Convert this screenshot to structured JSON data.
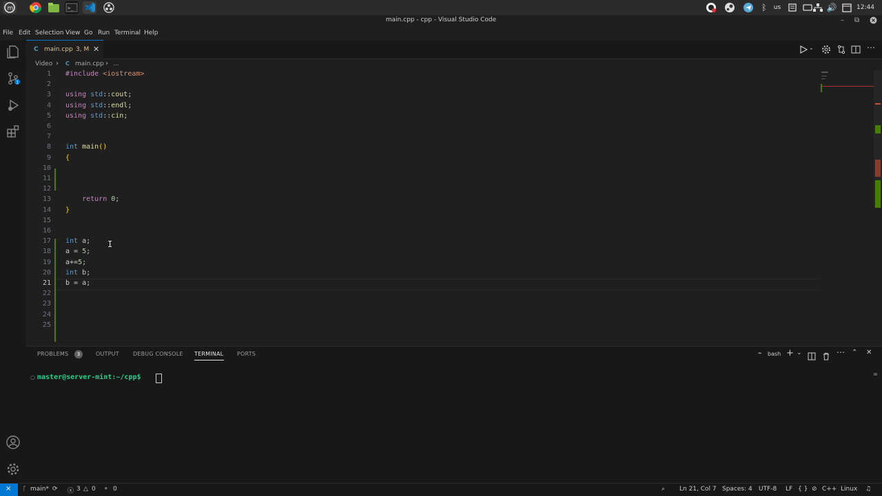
{
  "window": {
    "title": "main.cpp - cpp - Visual Studio Code"
  },
  "os_bar": {
    "clock": "12:44",
    "keyboard_layout": "us",
    "taskbar_icons": [
      "mint-menu-icon",
      "chrome-icon",
      "files-icon",
      "terminal-icon",
      "vscode-icon",
      "obs-icon"
    ]
  },
  "menu": [
    "File",
    "Edit",
    "Selection",
    "View",
    "Go",
    "Run",
    "Terminal",
    "Help"
  ],
  "tab": {
    "label": "main.cpp",
    "status": "3, M"
  },
  "breadcrumb": {
    "folder": "Video",
    "file": "main.cpp",
    "more": "..."
  },
  "editor": {
    "lines": [
      {
        "n": "1",
        "html": "<span class=\"pp\">#include</span> <span class=\"str\">&lt;iostream&gt;</span>"
      },
      {
        "n": "2",
        "html": ""
      },
      {
        "n": "3",
        "html": "<span class=\"pp\">using</span> <span class=\"kw\">std</span>::<span class=\"fn\">cout</span>;"
      },
      {
        "n": "4",
        "html": "<span class=\"pp\">using</span> <span class=\"kw\">std</span>::<span class=\"fn\">endl</span>;"
      },
      {
        "n": "5",
        "html": "<span class=\"pp\">using</span> <span class=\"kw\">std</span>::<span class=\"fn\">cin</span>;"
      },
      {
        "n": "6",
        "html": ""
      },
      {
        "n": "7",
        "html": ""
      },
      {
        "n": "8",
        "html": "<span class=\"kw\">int</span> <span class=\"fn\">main</span><span class=\"br\">()</span>"
      },
      {
        "n": "9",
        "html": "<span class=\"br\">{</span>"
      },
      {
        "n": "10",
        "html": ""
      },
      {
        "n": "11",
        "html": ""
      },
      {
        "n": "12",
        "html": ""
      },
      {
        "n": "13",
        "html": "    <span class=\"pp\">return</span> <span class=\"num\">0</span>;"
      },
      {
        "n": "14",
        "html": "<span class=\"br\">}</span>"
      },
      {
        "n": "15",
        "html": ""
      },
      {
        "n": "16",
        "html": ""
      },
      {
        "n": "17",
        "html": "<span class=\"kw\">int</span> a;"
      },
      {
        "n": "18",
        "html": "a = <span class=\"num\">5</span>;"
      },
      {
        "n": "19",
        "html": "a+=<span class=\"num\">5</span>;"
      },
      {
        "n": "20",
        "html": "<span class=\"kw\">int</span> b;"
      },
      {
        "n": "21",
        "html": "b = a;"
      },
      {
        "n": "22",
        "html": ""
      },
      {
        "n": "23",
        "html": ""
      },
      {
        "n": "24",
        "html": ""
      },
      {
        "n": "25",
        "html": ""
      }
    ],
    "current_line": "21"
  },
  "panel": {
    "tabs": [
      {
        "label": "PROBLEMS",
        "badge": "3"
      },
      {
        "label": "OUTPUT"
      },
      {
        "label": "DEBUG CONSOLE"
      },
      {
        "label": "TERMINAL"
      },
      {
        "label": "PORTS"
      }
    ],
    "active_tab": "TERMINAL",
    "shell": "bash",
    "prompt": "master@server-mint:~/cpp$"
  },
  "status": {
    "branch": "main*",
    "errors": "3",
    "warnings": "0",
    "ports": "0",
    "position": "Ln 21, Col 7",
    "spaces": "Spaces: 4",
    "encoding": "UTF-8",
    "eol": "LF",
    "language": "C++",
    "platform": "Linux"
  },
  "colors": {
    "accent": "#0078d4",
    "modified": "#e2c08d",
    "error": "#f14c4c"
  }
}
